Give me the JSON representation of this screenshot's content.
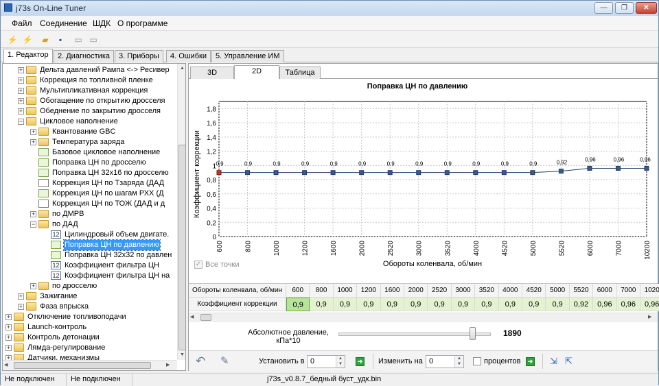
{
  "window": {
    "title": "j73s On-Line Tuner"
  },
  "menu": [
    "Файл",
    "Соединение",
    "ШДК",
    "О программе"
  ],
  "tabs": [
    "1. Редактор",
    "2. Диагностика",
    "3. Приборы",
    "4. Ошибки",
    "5. Управление ИМ"
  ],
  "tree": [
    {
      "label": "Дельта давлений Рампа <-> Ресивер",
      "icon": "folder-icon",
      "expander": "+",
      "level": 2
    },
    {
      "label": "Коррекция по топливной пленке",
      "icon": "folder-icon",
      "expander": "+",
      "level": 2
    },
    {
      "label": "Мультипликативная коррекция",
      "icon": "folder-icon",
      "expander": "+",
      "level": 2
    },
    {
      "label": "Обогащение по открытию дросселя",
      "icon": "folder-icon",
      "expander": "+",
      "level": 2
    },
    {
      "label": "Обеднение по закрытию дросселя",
      "icon": "folder-icon",
      "expander": "+",
      "level": 2
    },
    {
      "label": "Цикловое наполнение",
      "icon": "open-folder-icon",
      "expander": "−",
      "level": 2
    },
    {
      "label": "Квантование GBC",
      "icon": "folder-icon",
      "expander": "+",
      "level": 3
    },
    {
      "label": "Температура заряда",
      "icon": "folder-icon",
      "expander": "+",
      "level": 3
    },
    {
      "label": "Базовое цикловое наполнение",
      "icon": "curve-table-icon",
      "expander": "",
      "level": 3
    },
    {
      "label": "Поправка ЦН по дросселю",
      "icon": "curve-table-icon",
      "expander": "",
      "level": 3
    },
    {
      "label": "Поправка ЦН 32х16 по дросселю",
      "icon": "curve-table-icon",
      "expander": "",
      "level": 3
    },
    {
      "label": "Коррекция ЦН по Тзаряда  (ДАД",
      "icon": "chart-table-icon",
      "expander": "",
      "level": 3
    },
    {
      "label": "Коррекция ЦН по шагам РХХ  (Д",
      "icon": "curve-table-icon",
      "expander": "",
      "level": 3
    },
    {
      "label": "Коррекция ЦН по ТОЖ  (ДАД и д",
      "icon": "chart-table-icon",
      "expander": "",
      "level": 3
    },
    {
      "label": "по ДМРВ",
      "icon": "folder-icon",
      "expander": "+",
      "level": 3
    },
    {
      "label": "по ДАД",
      "icon": "open-folder-icon",
      "expander": "−",
      "level": 3
    },
    {
      "label": "Цилиндровый объем двигате.",
      "icon": "number-icon",
      "expander": "",
      "level": 4
    },
    {
      "label": "Поправка ЦН по давлению",
      "icon": "curve-table-icon",
      "expander": "",
      "level": 4,
      "selected": true
    },
    {
      "label": "Поправка ЦН 32х32 по давлен",
      "icon": "curve-table-icon",
      "expander": "",
      "level": 4
    },
    {
      "label": "Коэффициент фильтра ЦН",
      "icon": "number-icon",
      "expander": "",
      "level": 4
    },
    {
      "label": "Коэффициент фильтра ЦН на",
      "icon": "number-icon",
      "expander": "",
      "level": 4
    },
    {
      "label": "по дросселю",
      "icon": "folder-icon",
      "expander": "+",
      "level": 3
    },
    {
      "label": "Зажигание",
      "icon": "folder-icon",
      "expander": "+",
      "level": 2
    },
    {
      "label": "Фаза впрыска",
      "icon": "folder-icon",
      "expander": "+",
      "level": 2
    },
    {
      "label": "Отключение топливоподачи",
      "icon": "folder-icon",
      "expander": "+",
      "level": 1
    },
    {
      "label": "Launch-контроль",
      "icon": "folder-icon",
      "expander": "+",
      "level": 1
    },
    {
      "label": "Контроль детонации",
      "icon": "folder-icon",
      "expander": "+",
      "level": 1
    },
    {
      "label": "Лямда-регулирование",
      "icon": "folder-icon",
      "expander": "+",
      "level": 1
    },
    {
      "label": "Датчики, механизмы",
      "icon": "folder-icon",
      "expander": "+",
      "level": 1
    }
  ],
  "editor": {
    "subtabs": [
      "3D",
      "2D",
      "Таблица"
    ],
    "active_subtab": "2D",
    "all_points_label": "Все точки",
    "row_header_x": "Обороты коленвала, об/мин",
    "row_header_y": "Коэффициент коррекции",
    "slider_label_line1": "Абсолютное давление,",
    "slider_label_line2": "кПа*10",
    "slider_value": "1890",
    "slider_fraction": 0.88,
    "set_label": "Установить в",
    "set_value": "0",
    "change_label": "Изменить на",
    "change_value": "0",
    "percent_label": "процентов"
  },
  "chart_data": {
    "type": "line",
    "title": "Поправка ЦН по давлению",
    "xlabel": "Обороты коленвала, об/мин",
    "ylabel": "Коэффициент коррекции",
    "ylim": [
      0,
      1.9
    ],
    "yticks": [
      "0",
      "0,2",
      "0,4",
      "0,6",
      "0,8",
      "1",
      "1,2",
      "1,4",
      "1,6",
      "1,8"
    ],
    "categories": [
      "600",
      "800",
      "1000",
      "1200",
      "1600",
      "2000",
      "2520",
      "3000",
      "3520",
      "4000",
      "4520",
      "5000",
      "5520",
      "6000",
      "7000",
      "10200"
    ],
    "values": [
      0.9,
      0.9,
      0.9,
      0.9,
      0.9,
      0.9,
      0.9,
      0.9,
      0.9,
      0.9,
      0.9,
      0.9,
      0.92,
      0.96,
      0.96,
      0.96
    ],
    "point_labels": [
      "0,9",
      "0,9",
      "0,9",
      "0,9",
      "0,9",
      "0,9",
      "0,9",
      "0,9",
      "0,9",
      "0,9",
      "0,9",
      "0,9",
      "0,92",
      "0,96",
      "0,96",
      "0,96"
    ],
    "line_color": "#1f3f66",
    "grid": true
  },
  "table": {
    "x": [
      "600",
      "800",
      "1000",
      "1200",
      "1600",
      "2000",
      "2520",
      "3000",
      "3520",
      "4000",
      "4520",
      "5000",
      "5520",
      "6000",
      "7000",
      "1020"
    ],
    "y": [
      "0,9",
      "0,9",
      "0,9",
      "0,9",
      "0,9",
      "0,9",
      "0,9",
      "0,9",
      "0,9",
      "0,9",
      "0,9",
      "0,9",
      "0,92",
      "0,96",
      "0,96",
      "0,96"
    ]
  },
  "status": [
    "Не подключен",
    "Не подключен",
    "j73s_v0.8.7_бедный буст_удк.bin"
  ]
}
